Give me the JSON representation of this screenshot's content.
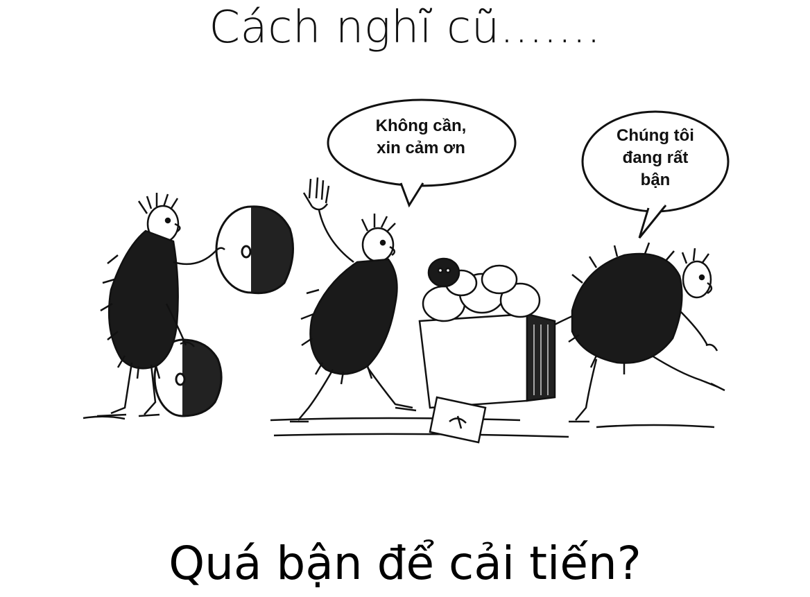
{
  "slide": {
    "title": "Cách nghĩ cũ.......",
    "caption": "Quá bận để cải tiến?"
  },
  "cartoon": {
    "speech_bubbles": [
      {
        "line1": "Không cần,",
        "line2": "xin cảm ơn"
      },
      {
        "line1": "Chúng tôi",
        "line2": "đang rất",
        "line3": "bận"
      }
    ],
    "colors": {
      "ink": "#111111",
      "background": "#ffffff"
    }
  }
}
